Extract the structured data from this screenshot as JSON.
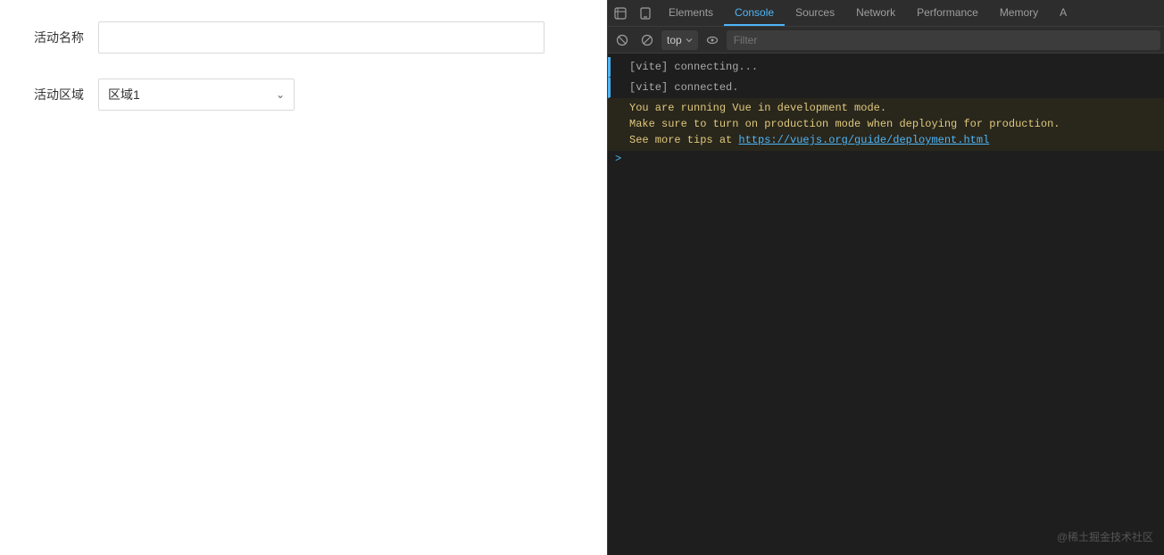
{
  "left": {
    "fields": [
      {
        "label": "活动名称",
        "type": "input",
        "value": "",
        "placeholder": ""
      },
      {
        "label": "活动区域",
        "type": "select",
        "value": "区域1"
      }
    ]
  },
  "devtools": {
    "tabs": [
      {
        "id": "elements",
        "label": "Elements",
        "active": false
      },
      {
        "id": "console",
        "label": "Console",
        "active": true
      },
      {
        "id": "sources",
        "label": "Sources",
        "active": false
      },
      {
        "id": "network",
        "label": "Network",
        "active": false
      },
      {
        "id": "performance",
        "label": "Performance",
        "active": false
      },
      {
        "id": "memory",
        "label": "Memory",
        "active": false
      },
      {
        "id": "more",
        "label": "A",
        "active": false
      }
    ],
    "toolbar2": {
      "top_selector_label": "top",
      "filter_placeholder": "Filter"
    },
    "console_lines": [
      {
        "type": "info",
        "text": "[vite] connecting..."
      },
      {
        "type": "info",
        "text": "[vite] connected."
      },
      {
        "type": "warning",
        "text": "You are running Vue in development mode.\nMake sure to turn on production mode when deploying for production.\nSee more tips at ",
        "link": "https://vuejs.org/guide/deployment.html",
        "link_text": "https://vuejs.org/guide/deployment.html"
      }
    ],
    "watermark": "@稀土掘金技术社区"
  }
}
